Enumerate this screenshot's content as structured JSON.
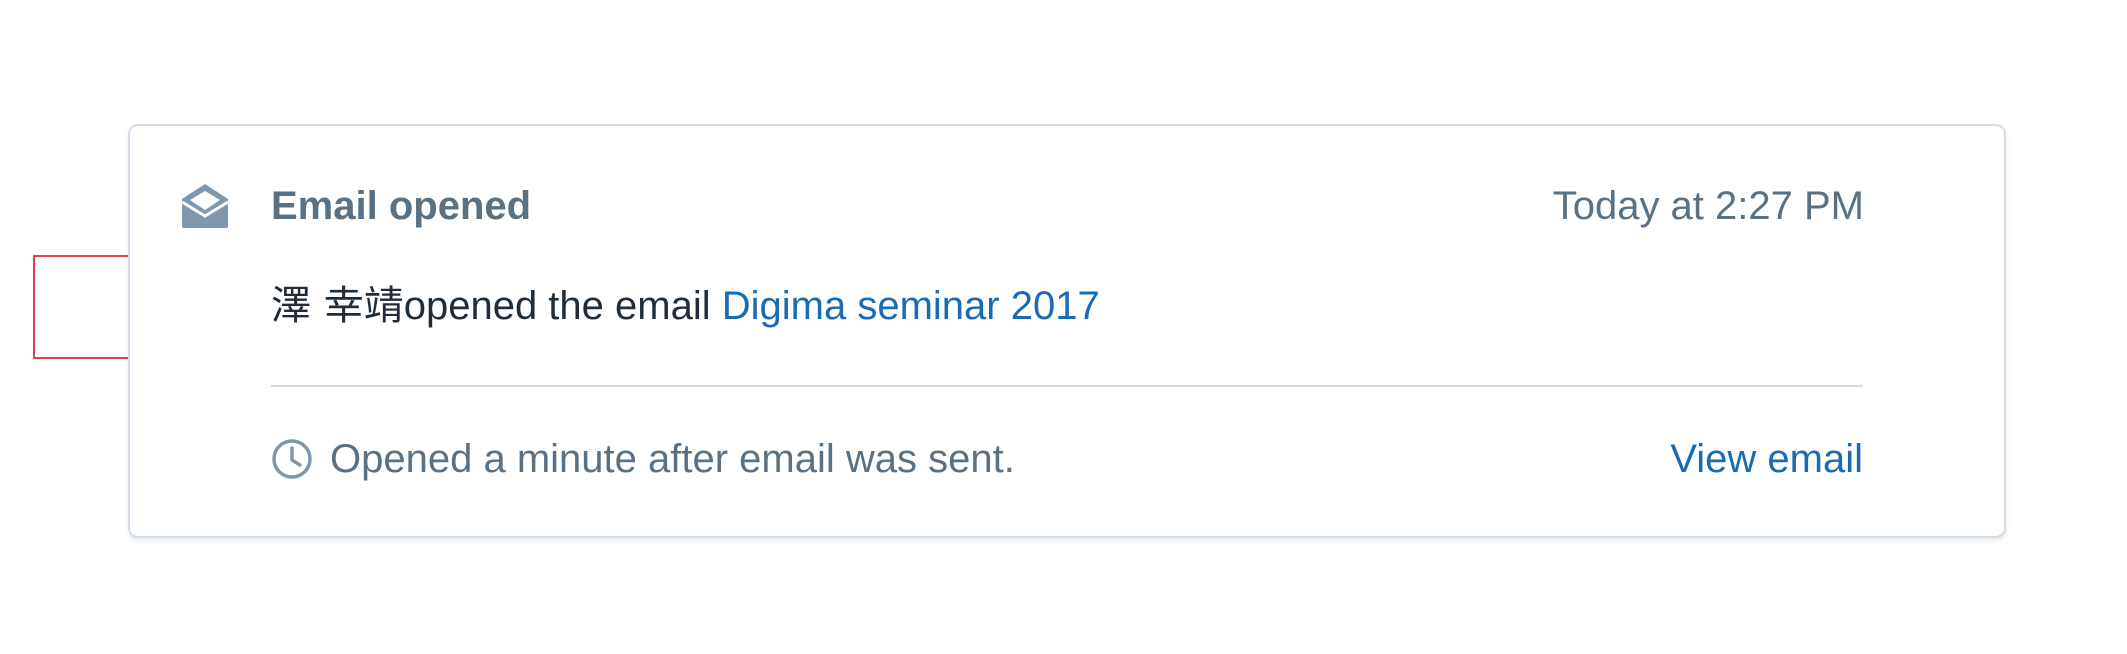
{
  "activity": {
    "icon": "envelope-open-icon",
    "title": "Email opened",
    "timestamp": "Today at 2:27 PM",
    "contact_name": "澤 幸靖",
    "action_text": "opened the email ",
    "email_subject": "Digima seminar 2017",
    "footer_icon": "clock-icon",
    "footer_text": "Opened a minute after email was sent.",
    "view_link": "View email"
  },
  "colors": {
    "muted_text": "#5a7184",
    "body_text": "#1f2d3a",
    "link": "#1a6bb5",
    "border": "#d3dce6",
    "highlight": "#e0434b"
  }
}
